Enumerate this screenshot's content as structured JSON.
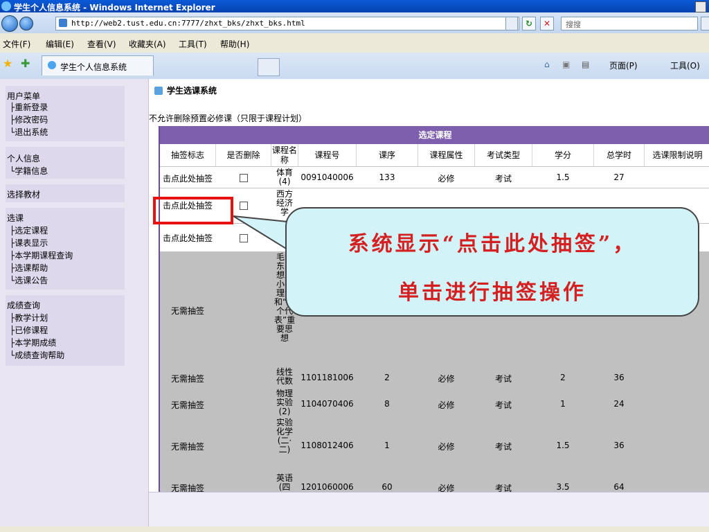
{
  "window": {
    "title": "学生个人信息系统 - Windows Internet Explorer"
  },
  "address_bar": {
    "url": "http://web2.tust.edu.cn:7777/zhxt_bks/zhxt_bks.html",
    "search_placeholder": "搜搜"
  },
  "menu": [
    "文件(F)",
    "编辑(E)",
    "查看(V)",
    "收藏夹(A)",
    "工具(T)",
    "帮助(H)"
  ],
  "tab": {
    "label": "学生个人信息系统"
  },
  "toolbar_right": {
    "page": "页面(P)",
    "tools": "工具(O)"
  },
  "sidebar": {
    "user_menu": "用户菜单",
    "user_items": [
      "├重新登录",
      "├修改密码",
      "└退出系统"
    ],
    "personal": "个人信息",
    "personal_items": [
      "└学籍信息"
    ],
    "textbook": "选择教材",
    "course": "选课",
    "course_items": [
      "├选定课程",
      "├课表显示",
      "├本学期课程查询",
      "├选课帮助",
      "└选课公告"
    ],
    "grades": "成绩查询",
    "grade_items": [
      "├教学计划",
      "├已修课程",
      "├本学期成绩",
      "└成绩查询帮助"
    ]
  },
  "main": {
    "title": "学生选课系统",
    "notice": "不允许删除预置必修课（只限于课程计划）",
    "table_title": "选定课程",
    "columns": [
      "抽签标志",
      "是否删除",
      "课程名称",
      "课程号",
      "课序",
      "课程属性",
      "考试类型",
      "学分",
      "总学时",
      "选课限制说明"
    ],
    "rows": [
      {
        "lottery": "击点此处抽签",
        "name": "体育(4)",
        "code": "0091040006",
        "seq": "133",
        "attr": "必修",
        "exam": "考试",
        "credit": "1.5",
        "hours": "27"
      },
      {
        "lottery": "击点此处抽签",
        "name": "西方经济学",
        "code": "",
        "seq": "",
        "attr": "",
        "exam": "",
        "credit": "",
        "hours": ""
      },
      {
        "lottery": "击点此处抽签",
        "name": "",
        "code": "",
        "seq": "",
        "attr": "",
        "exam": "",
        "credit": "",
        "hours": ""
      },
      {
        "lottery": "无需抽签",
        "name": "毛泽东思想邓小平理论和“三个代表”重要思想",
        "code": "",
        "seq": "",
        "attr": "",
        "exam": "",
        "credit": "",
        "hours": ""
      },
      {
        "lottery": "无需抽签",
        "name": "线性代数",
        "code": "1101181006",
        "seq": "2",
        "attr": "必修",
        "exam": "考试",
        "credit": "2",
        "hours": "36"
      },
      {
        "lottery": "无需抽签",
        "name": "物理实验(2)",
        "code": "1104070406",
        "seq": "8",
        "attr": "必修",
        "exam": "考试",
        "credit": "1",
        "hours": "24"
      },
      {
        "lottery": "无需抽签",
        "name": "实验化学(二·二)",
        "code": "1108012406",
        "seq": "1",
        "attr": "必修",
        "exam": "考试",
        "credit": "1.5",
        "hours": "36"
      },
      {
        "lottery": "无需抽签",
        "name": "英语(四",
        "code": "1201060006",
        "seq": "60",
        "attr": "必修",
        "exam": "考试",
        "credit": "3.5",
        "hours": "64"
      }
    ]
  },
  "callout": {
    "line1": "系统显示“点击此处抽签”，",
    "line2": "单击进行抽签操作"
  },
  "colors": {
    "table_header": "#7d5fae",
    "sidebar_bg": "#e8e4f2",
    "callout_text": "#d42020",
    "callout_bg": "#d2f3f7",
    "highlight": "#e81010"
  }
}
